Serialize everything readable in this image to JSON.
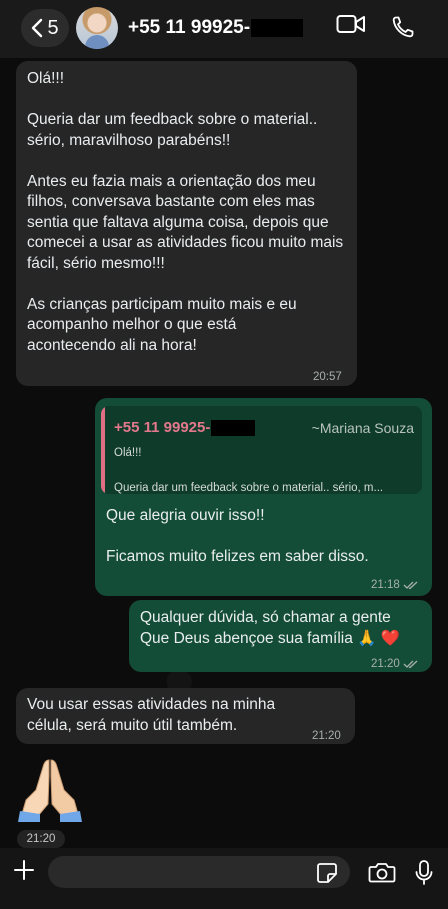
{
  "header": {
    "back_count": "5",
    "contact_number": "+55 11 99925-"
  },
  "messages": {
    "m1": {
      "paragraphs": [
        "Olá!!!",
        "Queria dar um feedback sobre o material.. sério, maravilhoso parabéns!!",
        "Antes eu fazia mais a orientação dos meu filhos, conversava bastante com eles mas sentia que faltava alguma coisa, depois que comecei a usar as atividades ficou muito mais fácil, sério mesmo!!!",
        "As crianças participam muito mais e eu acompanho melhor o que está acontecendo ali na hora!"
      ],
      "time": "20:57"
    },
    "m2": {
      "quote": {
        "name": "+55 11 99925-",
        "author": "~Mariana Souza",
        "line1": "Olá!!!",
        "line2": "Queria dar um feedback sobre o material.. sério, m..."
      },
      "line1": "Que alegria ouvir isso!!",
      "line2": "Ficamos muito felizes em saber disso.",
      "time": "21:18"
    },
    "m3": {
      "line1": "Qualquer dúvida, só chamar a gente",
      "line2": "Que Deus abençoe sua família 🙏 ❤️",
      "time": "21:20"
    },
    "m4": {
      "text": "Vou usar essas atividades na minha célula, será muito útil também.",
      "time": "21:20"
    },
    "m5": {
      "time": "21:20"
    }
  },
  "composer": {
    "placeholder": ""
  },
  "icons": {
    "back": "chevron-left-icon",
    "video": "video-call-icon",
    "phone": "phone-icon",
    "plus": "plus-icon",
    "sticker": "sticker-icon",
    "camera": "camera-icon",
    "mic": "microphone-icon",
    "read": "double-check-icon"
  },
  "colors": {
    "incoming_bubble": "#262626",
    "outgoing_bubble": "#144d37",
    "quote_accent": "#e06f86"
  }
}
